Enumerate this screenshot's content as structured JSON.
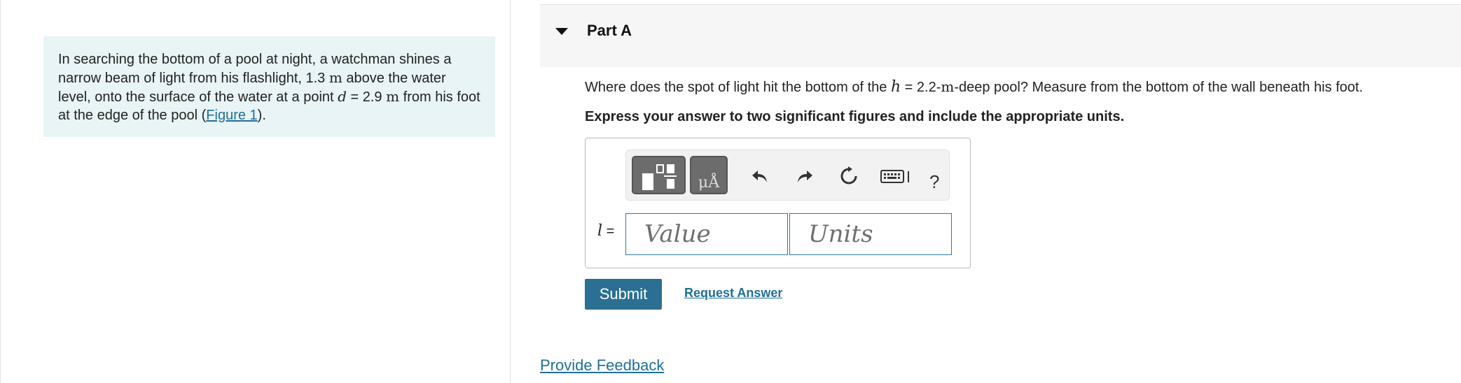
{
  "problem": {
    "text_1": "In searching the bottom of a pool at night, a watchman shines a narrow beam of light from his flashlight, 1.3 ",
    "unit_m_1": "m",
    "text_2": " above the water level, onto the surface of the water at a point ",
    "var_d": "d",
    "text_3": " = 2.9 ",
    "unit_m_2": "m",
    "text_4": " from his foot at the edge of the pool (",
    "figure_link": "Figure 1",
    "text_5": ")."
  },
  "part": {
    "title": "Part A",
    "question_1": "Where does the spot of light hit the bottom of the ",
    "var_h": "h",
    "question_2": " = 2.2-",
    "unit_m": "m",
    "question_3": "-deep pool? Measure from the bottom of the wall beneath his foot.",
    "instruction": "Express your answer to two significant figures and include the appropriate units."
  },
  "toolbar": {
    "templates_icon": "templates-icon",
    "units_glyph": "μÅ",
    "undo_icon": "undo-icon",
    "redo_icon": "redo-icon",
    "reset_icon": "reset-icon",
    "keyboard_icon": "keyboard-icon",
    "help_label": "?"
  },
  "answer": {
    "variable": "l",
    "equals": " =",
    "value_placeholder": "Value",
    "units_placeholder": "Units"
  },
  "actions": {
    "submit_label": "Submit",
    "request_answer_label": "Request Answer",
    "feedback_label": "Provide Feedback"
  },
  "colors": {
    "problem_bg": "#e8f4f5",
    "link": "#1f6f99",
    "submit_bg": "#2b6f93",
    "input_border": "#2a7aa8"
  }
}
